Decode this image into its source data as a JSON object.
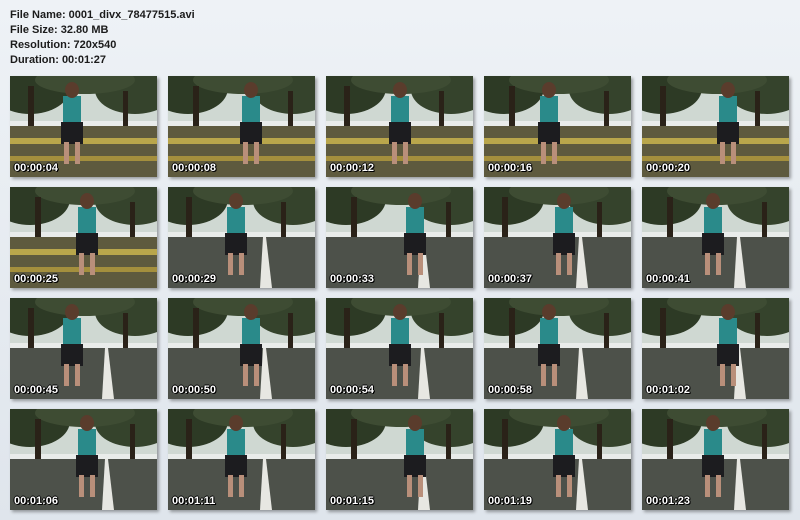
{
  "file_info": {
    "name_label": "File Name: 0001_divx_78477515.avi",
    "size_label": "File Size: 32.80 MB",
    "resolution_label": "Resolution: 720x540",
    "duration_label": "Duration: 00:01:27"
  },
  "thumbnails": [
    {
      "timestamp": "00:00:04"
    },
    {
      "timestamp": "00:00:08"
    },
    {
      "timestamp": "00:00:12"
    },
    {
      "timestamp": "00:00:16"
    },
    {
      "timestamp": "00:00:20"
    },
    {
      "timestamp": "00:00:25"
    },
    {
      "timestamp": "00:00:29"
    },
    {
      "timestamp": "00:00:33"
    },
    {
      "timestamp": "00:00:37"
    },
    {
      "timestamp": "00:00:41"
    },
    {
      "timestamp": "00:00:45"
    },
    {
      "timestamp": "00:00:50"
    },
    {
      "timestamp": "00:00:54"
    },
    {
      "timestamp": "00:00:58"
    },
    {
      "timestamp": "00:01:02"
    },
    {
      "timestamp": "00:01:06"
    },
    {
      "timestamp": "00:01:11"
    },
    {
      "timestamp": "00:01:15"
    },
    {
      "timestamp": "00:01:19"
    },
    {
      "timestamp": "00:01:23"
    }
  ]
}
